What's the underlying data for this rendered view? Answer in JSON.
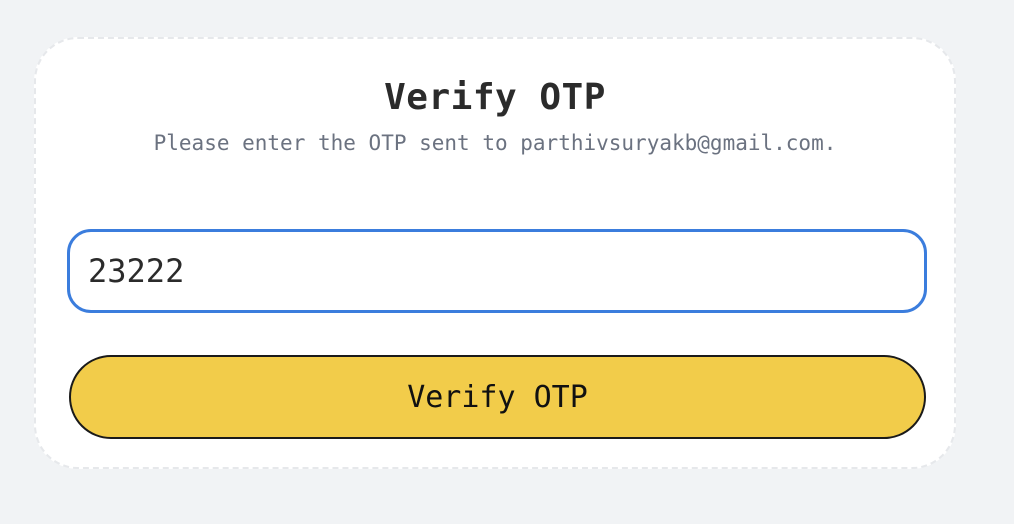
{
  "verify_card": {
    "title": "Verify OTP",
    "subtitle": "Please enter the OTP sent to parthivsuryakb@gmail.com.",
    "otp_input": {
      "value": "23222",
      "placeholder": ""
    },
    "verify_button_label": "Verify OTP"
  },
  "colors": {
    "page_background": "#f1f3f5",
    "input_focus_border": "#3b7ddd",
    "button_background": "#f2cc4a"
  }
}
